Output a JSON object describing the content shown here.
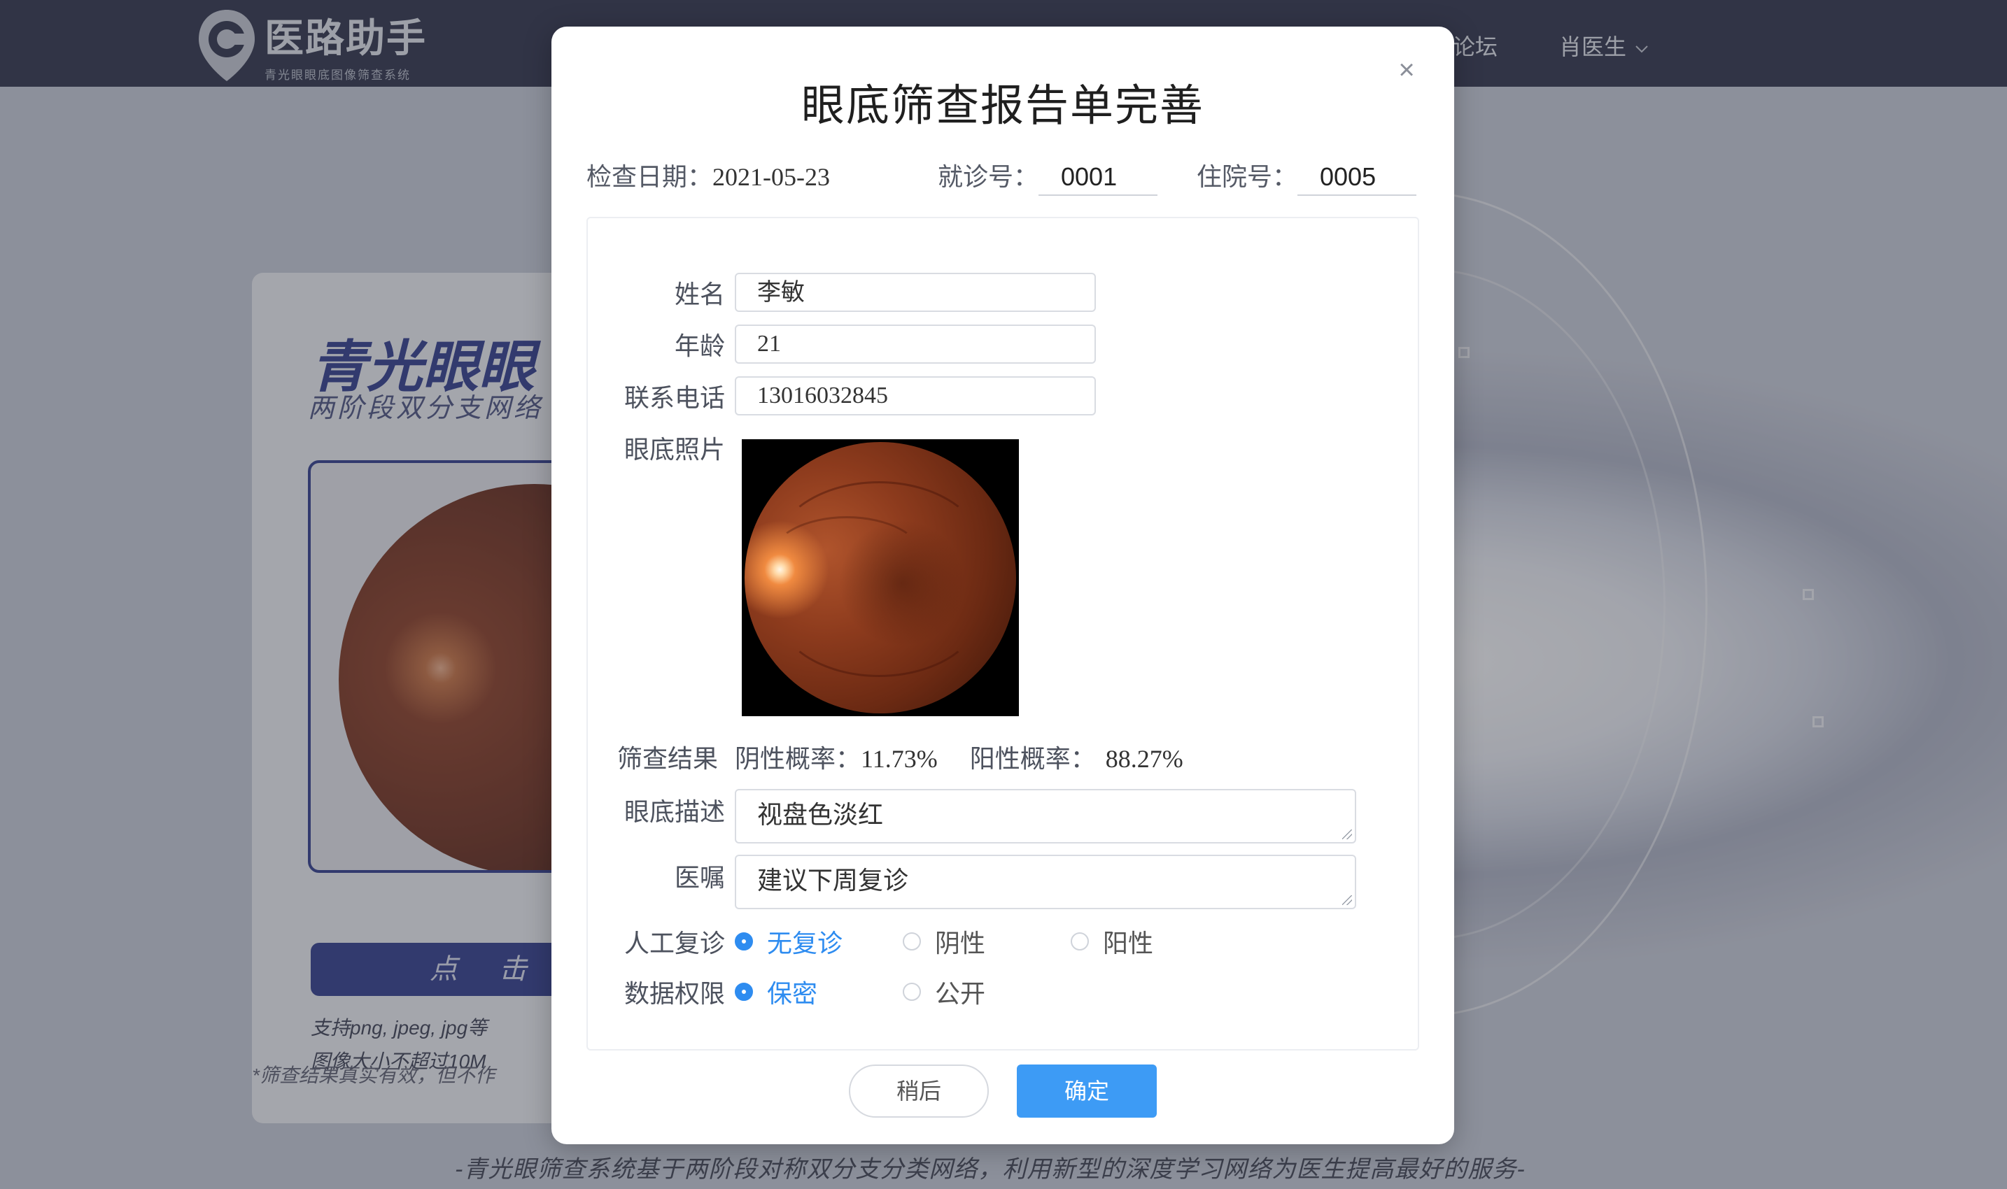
{
  "header": {
    "logo_title": "医路助手",
    "logo_subtitle": "青光眼眼底图像筛查系统",
    "nav_forum": "论坛",
    "user_name": "肖医生"
  },
  "background": {
    "upload_title": "青光眼眼",
    "upload_subtitle": "两阶段双分支网络",
    "upload_button": "点 击 伤",
    "hint_formats": "支持png, jpeg, jpg等",
    "hint_size": "图像大小不超过10M",
    "card_note": "*筛查结果真实有效，但不作",
    "footer": "-青光眼筛查系统基于两阶段对称双分支分类网络，利用新型的深度学习网络为医生提高最好的服务-"
  },
  "modal": {
    "title": "眼底筛查报告单完善",
    "close_symbol": "×",
    "exam_date_label": "检查日期：",
    "exam_date_value": "2021-05-23",
    "visit_no_label": "就诊号：",
    "visit_no_value": "0001",
    "inpatient_no_label": "住院号：",
    "inpatient_no_value": "0005",
    "form": {
      "name_label": "姓名",
      "name_value": "李敏",
      "age_label": "年龄",
      "age_value": "21",
      "phone_label": "联系电话",
      "phone_value": "13016032845",
      "photo_label": "眼底照片",
      "result_label": "筛查结果",
      "negative_label": "阴性概率：",
      "negative_value": "11.73%",
      "positive_label": "阳性概率：",
      "positive_value": "88.27%",
      "description_label": "眼底描述",
      "description_value": "视盘色淡红",
      "advice_label": "医嘱",
      "advice_value": "建议下周复诊",
      "review_label": "人工复诊",
      "review_options": [
        "无复诊",
        "阴性",
        "阳性"
      ],
      "review_selected": "无复诊",
      "permission_label": "数据权限",
      "permission_options": [
        "保密",
        "公开"
      ],
      "permission_selected": "保密"
    },
    "later_button": "稍后",
    "confirm_button": "确定"
  },
  "colors": {
    "topbar": "#2b3048",
    "primary_blue": "#3d9bf5",
    "checked_radio": "#2e8cf0",
    "brand_indigo": "#2e3a8c"
  }
}
